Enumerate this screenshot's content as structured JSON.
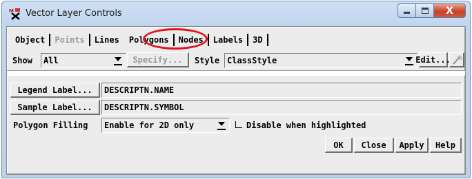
{
  "window": {
    "title": "Vector Layer Controls",
    "close_glyph": "X"
  },
  "tabs": [
    {
      "label": "Object",
      "enabled": true
    },
    {
      "label": "Points",
      "enabled": false
    },
    {
      "label": "Lines",
      "enabled": true
    },
    {
      "label": "Polygons",
      "enabled": true,
      "selected": true,
      "highlighted": true
    },
    {
      "label": "Nodes",
      "enabled": true
    },
    {
      "label": "Labels",
      "enabled": true
    },
    {
      "label": "3D",
      "enabled": true
    }
  ],
  "show_row": {
    "show_label": "Show",
    "show_value": "All",
    "specify_label": "Specify...",
    "style_label": "Style",
    "style_value": "ClassStyle",
    "edit_label": "Edit..."
  },
  "polygons": {
    "legend_label_button": "Legend Label...",
    "legend_label_value": "DESCRIPTN.NAME",
    "sample_label_button": "Sample Label...",
    "sample_label_value": "DESCRIPTN.SYMBOL",
    "filling_label": "Polygon Filling",
    "filling_value": "Enable for 2D only",
    "disable_highlight_label": "Disable when highlighted",
    "disable_highlight_checked": false
  },
  "actions": {
    "ok": "OK",
    "close": "Close",
    "apply": "Apply",
    "help": "Help"
  },
  "colors": {
    "highlight_ring": "#e0141e",
    "window_frame": "#c0d5ee",
    "dialog_bg": "#ececec",
    "close_button": "#c7442b"
  },
  "icons": [
    "app-icon",
    "minimize-icon",
    "maximize-icon",
    "close-icon",
    "dropdown-arrow-icon",
    "style-wand-icon",
    "checkbox-icon"
  ]
}
